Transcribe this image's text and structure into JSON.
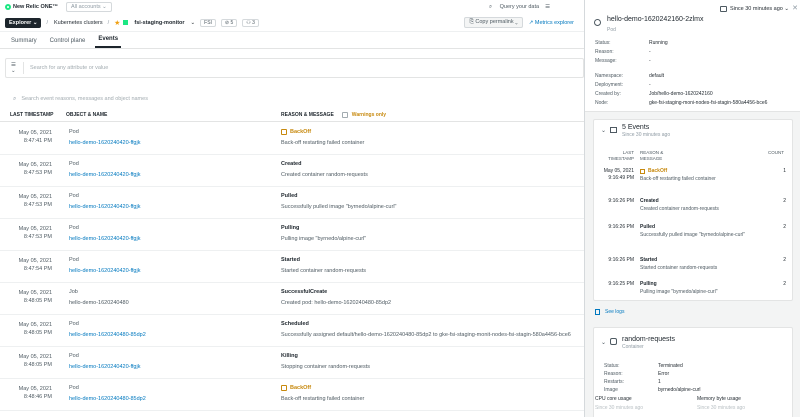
{
  "topbar": {
    "brand": "New Relic ONE™",
    "account": "All accounts",
    "query": "Query your data",
    "since": "Since 30 minutes ago"
  },
  "breadcrumb": {
    "explorer": "Explorer",
    "clusters": "Kubernetes clusters",
    "entity": "fsi-staging-monitor",
    "fsi": "FSI",
    "tags": "5",
    "users": "3",
    "copy": "Copy permalink",
    "metrics": "Metrics explorer"
  },
  "tabs": [
    "Summary",
    "Control plane",
    "Events"
  ],
  "filter": {
    "placeholder": "Search for any attribute or value"
  },
  "search": {
    "placeholder": "Search event reasons, messages and object names"
  },
  "table": {
    "headers": {
      "ts": "LAST TIMESTAMP",
      "obj": "OBJECT & NAME",
      "rm": "REASON & MESSAGE",
      "warn": "Warnings only"
    },
    "rows": [
      {
        "date": "May 05, 2021",
        "time": "8:47:41 PM",
        "kind": "Pod",
        "name": "hello-demo-1620240420-ffgjk",
        "reason": "BackOff",
        "msg": "Back-off restarting failed container",
        "warn": true,
        "link": true
      },
      {
        "date": "May 05, 2021",
        "time": "8:47:53 PM",
        "kind": "Pod",
        "name": "hello-demo-1620240420-ffgjk",
        "reason": "Created",
        "msg": "Created container random-requests",
        "warn": false,
        "link": true
      },
      {
        "date": "May 05, 2021",
        "time": "8:47:53 PM",
        "kind": "Pod",
        "name": "hello-demo-1620240420-ffgjk",
        "reason": "Pulled",
        "msg": "Successfully pulled image \"byrnedo/alpine-curl\"",
        "warn": false,
        "link": true
      },
      {
        "date": "May 05, 2021",
        "time": "8:47:53 PM",
        "kind": "Pod",
        "name": "hello-demo-1620240420-ffgjk",
        "reason": "Pulling",
        "msg": "Pulling image \"byrnedo/alpine-curl\"",
        "warn": false,
        "link": true
      },
      {
        "date": "May 05, 2021",
        "time": "8:47:54 PM",
        "kind": "Pod",
        "name": "hello-demo-1620240420-ffgjk",
        "reason": "Started",
        "msg": "Started container random-requests",
        "warn": false,
        "link": true
      },
      {
        "date": "May 05, 2021",
        "time": "8:48:05 PM",
        "kind": "Job",
        "name": "hello-demo-1620240480",
        "reason": "SuccessfulCreate",
        "msg": "Created pod: hello-demo-1620240480-85dp2",
        "warn": false,
        "link": false
      },
      {
        "date": "May 05, 2021",
        "time": "8:48:05 PM",
        "kind": "Pod",
        "name": "hello-demo-1620240480-85dp2",
        "reason": "Scheduled",
        "msg": "Successfully assigned default/hello-demo-1620240480-85dp2 to gke-fsi-staging-monit-nodes-fsi-stagin-580a4456-bce6",
        "warn": false,
        "link": true
      },
      {
        "date": "May 05, 2021",
        "time": "8:48:05 PM",
        "kind": "Pod",
        "name": "hello-demo-1620240420-ffgjk",
        "reason": "Killing",
        "msg": "Stopping container random-requests",
        "warn": false,
        "link": true
      },
      {
        "date": "May 05, 2021",
        "time": "8:48:46 PM",
        "kind": "Pod",
        "name": "hello-demo-1620240480-85dp2",
        "reason": "BackOff",
        "msg": "Back-off restarting failed container",
        "warn": true,
        "link": true
      }
    ]
  },
  "panel": {
    "title": "hello-demo-1620242160-2zlmx",
    "subtitle": "Pod",
    "since": "Since 30 minutes ago",
    "kv1": [
      {
        "k": "Status:",
        "v": "Running"
      },
      {
        "k": "Reason:",
        "v": "-"
      },
      {
        "k": "Message:",
        "v": "-"
      }
    ],
    "kv2": [
      {
        "k": "Namespace:",
        "v": "default"
      },
      {
        "k": "Deployment:",
        "v": "-"
      },
      {
        "k": "Created by:",
        "v": "Job/hello-demo-1620242160"
      },
      {
        "k": "Node:",
        "v": "gke-fsi-staging-moni-nodes-fsi-stagin-580a4456-bce6"
      }
    ],
    "events": {
      "title": "5 Events",
      "sub": "Since 30 minutes ago",
      "th_last": "LAST",
      "th_ts": "TIMESTAMP",
      "th_reason": "REASON &",
      "th_msg": "MESSAGE",
      "th_count": "COUNT",
      "rows": [
        {
          "date": "May 05, 2021",
          "time": "9:16:49 PM",
          "reason": "BackOff",
          "msg": "Back-off restarting failed container",
          "count": "1",
          "warn": true
        },
        {
          "date": "",
          "time": "9:16:26 PM",
          "reason": "Created",
          "msg": "Created container random-requests",
          "count": "2",
          "warn": false
        },
        {
          "date": "",
          "time": "9:16:26 PM",
          "reason": "Pulled",
          "msg": "Successfully pulled image \"byrnedo/alpine-curl\"",
          "count": "2",
          "warn": false
        },
        {
          "date": "",
          "time": "9:16:26 PM",
          "reason": "Started",
          "msg": "Started container random-requests",
          "count": "2",
          "warn": false
        },
        {
          "date": "",
          "time": "9:16:25 PM",
          "reason": "Pulling",
          "msg": "Pulling image \"byrnedo/alpine-curl\"",
          "count": "2",
          "warn": false
        }
      ]
    },
    "see_logs": "See logs",
    "container": {
      "title": "random-requests",
      "sub": "Container",
      "kv": [
        {
          "k": "Status:",
          "v": "Terminated"
        },
        {
          "k": "Reason:",
          "v": "Error"
        },
        {
          "k": "Restarts:",
          "v": "1"
        },
        {
          "k": "Image",
          "v": "byrnedo/alpine-curl"
        }
      ],
      "cpu": "CPU core usage",
      "mem": "Memory byte usage",
      "since": "Since 30 minutes ago"
    }
  }
}
